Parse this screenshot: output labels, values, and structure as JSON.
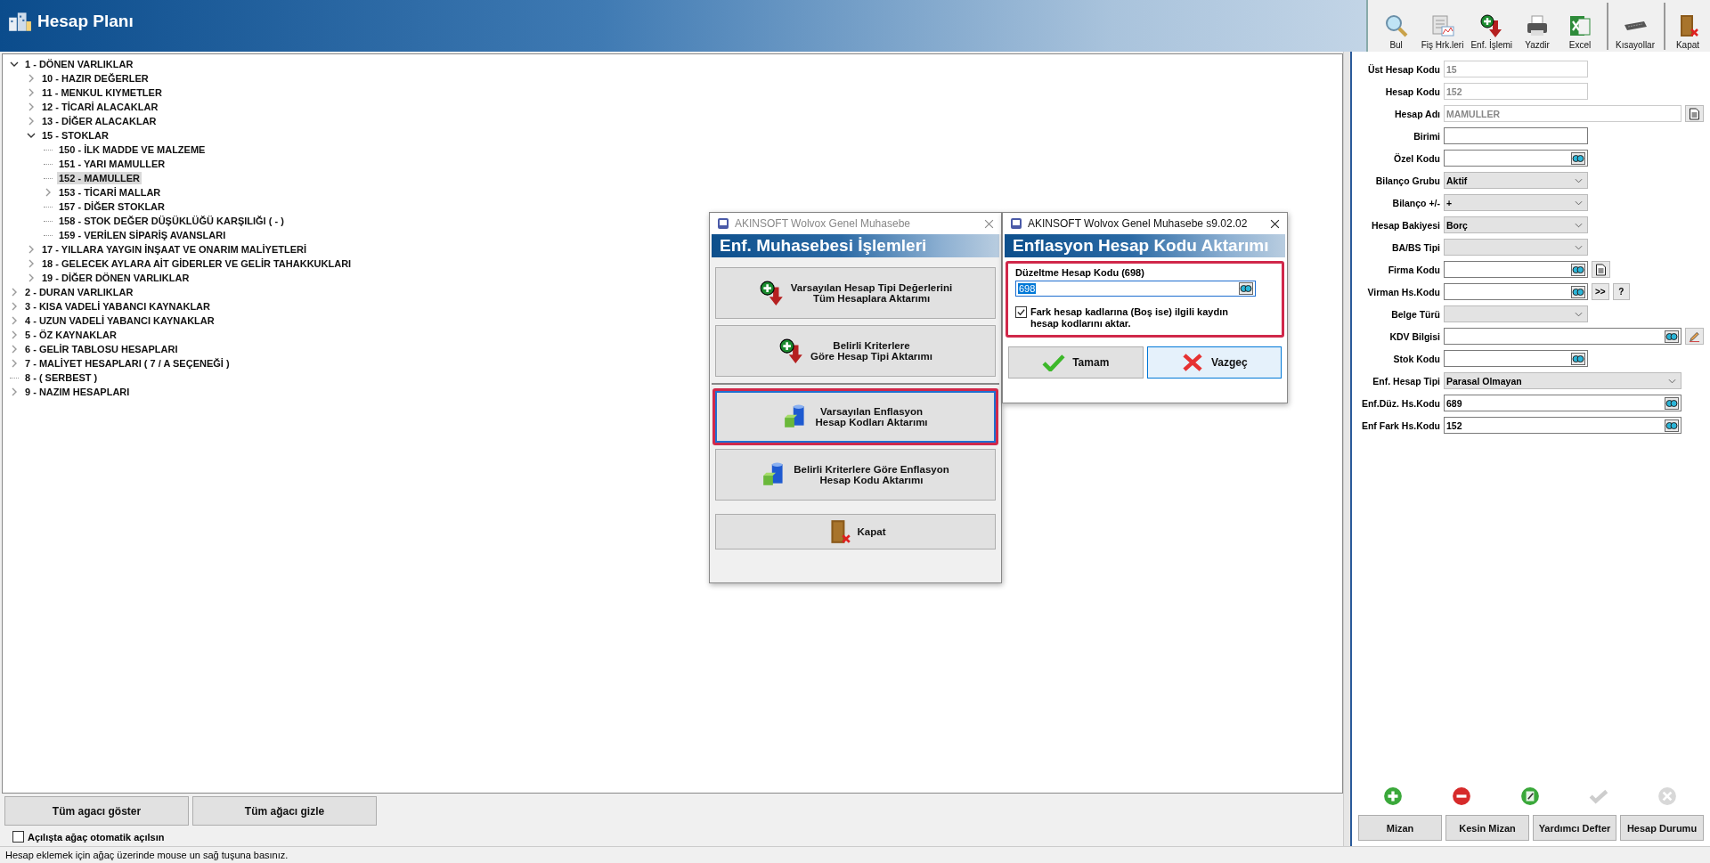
{
  "window": {
    "title": "Hesap Planı"
  },
  "toolbar": [
    {
      "label": "Bul",
      "kind": "search",
      "separated": false
    },
    {
      "label": "Fiş Hrk.leri",
      "kind": "report",
      "separated": false
    },
    {
      "label": "Enf. İşlemi",
      "kind": "add-down",
      "separated": false
    },
    {
      "label": "Yazdir",
      "kind": "printer",
      "separated": false
    },
    {
      "label": "Excel",
      "kind": "excel",
      "separated": false
    },
    {
      "label": "Kısayollar",
      "kind": "keyboard",
      "separated": true
    },
    {
      "label": "Kapat",
      "kind": "door",
      "separated": true
    }
  ],
  "tree": [
    {
      "label": "1 - DÖNEN VARLIKLAR",
      "expanded": true,
      "selected": false,
      "children": [
        {
          "label": "10 - HAZIR DEĞERLER",
          "expanded": false,
          "selected": false
        },
        {
          "label": "11 - MENKUL KIYMETLER",
          "expanded": false,
          "selected": false
        },
        {
          "label": "12 - TİCARİ ALACAKLAR",
          "expanded": false,
          "selected": false
        },
        {
          "label": "13 - DİĞER ALACAKLAR",
          "expanded": false,
          "selected": false
        },
        {
          "label": "15 - STOKLAR",
          "expanded": true,
          "selected": false,
          "children": [
            {
              "label": "150 - İLK MADDE VE MALZEME",
              "selected": false
            },
            {
              "label": "151 - YARI MAMULLER",
              "selected": false
            },
            {
              "label": "152 - MAMULLER",
              "selected": true
            },
            {
              "label": "153 - TİCARİ MALLAR",
              "expanded": false,
              "selected": false
            },
            {
              "label": "157 - DİĞER STOKLAR",
              "selected": false
            },
            {
              "label": "158 - STOK DEĞER DÜŞÜKLÜĞÜ KARŞILIĞI ( - )",
              "selected": false
            },
            {
              "label": "159 - VERİLEN SİPARİŞ AVANSLARI",
              "selected": false
            }
          ]
        },
        {
          "label": "17 - YILLARA YAYGIN İNŞAAT VE ONARIM MALİYETLERİ",
          "expanded": false,
          "selected": false
        },
        {
          "label": "18 - GELECEK AYLARA AİT GİDERLER VE GELİR TAHAKKUKLARI",
          "expanded": false,
          "selected": false
        },
        {
          "label": "19 - DİĞER DÖNEN VARLIKLAR",
          "expanded": false,
          "selected": false
        }
      ]
    },
    {
      "label": "2 - DURAN VARLIKLAR",
      "expanded": false,
      "selected": false
    },
    {
      "label": "3 - KISA VADELİ YABANCI KAYNAKLAR",
      "expanded": false,
      "selected": false
    },
    {
      "label": "4 - UZUN VADELİ YABANCI KAYNAKLAR",
      "expanded": false,
      "selected": false
    },
    {
      "label": "5 - ÖZ KAYNAKLAR",
      "expanded": false,
      "selected": false
    },
    {
      "label": "6 - GELİR TABLOSU HESAPLARI",
      "expanded": false,
      "selected": false
    },
    {
      "label": "7 - MALİYET HESAPLARI ( 7 / A  SEÇENEĞİ )",
      "expanded": false,
      "selected": false
    },
    {
      "label": "8 - ( SERBEST )",
      "selected": false
    },
    {
      "label": "9 - NAZIM HESAPLARI",
      "expanded": false,
      "selected": false
    }
  ],
  "tree_buttons": [
    "Tüm agacı göster",
    "Tüm ağacı gizle"
  ],
  "auto_expand": {
    "label": "Açılışta ağaç otomatik açılsın",
    "checked": false
  },
  "form": [
    {
      "label": "Üst Hesap Kodu",
      "kind": "text",
      "value": "15",
      "disabled": true,
      "wide": false
    },
    {
      "label": "Hesap Kodu",
      "kind": "text",
      "value": "152",
      "disabled": true,
      "wide": false
    },
    {
      "label": "Hesap Adı",
      "kind": "text",
      "value": "MAMULLER",
      "disabled": true,
      "wide": true,
      "extras": [
        {
          "kind": "note"
        }
      ]
    },
    {
      "label": "Birimi",
      "kind": "text",
      "disabled": false,
      "wide": false
    },
    {
      "label": "Özel Kodu",
      "kind": "lookup",
      "disabled": false,
      "wide": false
    },
    {
      "label": "Bilanço Grubu",
      "kind": "select",
      "value": "Aktif",
      "disabled": false,
      "wide": false
    },
    {
      "label": "Bilanço +/-",
      "kind": "select",
      "value": "+",
      "disabled": false,
      "wide": false
    },
    {
      "label": "Hesap Bakiyesi",
      "kind": "select",
      "value": "Borç",
      "disabled": false,
      "wide": false
    },
    {
      "label": "BA/BS Tipi",
      "kind": "select",
      "disabled": false,
      "wide": false
    },
    {
      "label": "Firma Kodu",
      "kind": "lookup",
      "disabled": false,
      "wide": false,
      "extras": [
        {
          "kind": "note"
        }
      ]
    },
    {
      "label": "Virman Hs.Kodu",
      "kind": "lookup",
      "disabled": false,
      "wide": false,
      "extras": [
        {
          "kind": "text",
          "label": ">>"
        },
        {
          "kind": "text",
          "label": "?"
        }
      ]
    },
    {
      "label": "Belge Türü",
      "kind": "select",
      "disabled": false,
      "wide": false
    },
    {
      "label": "KDV Bilgisi",
      "kind": "lookup",
      "disabled": false,
      "wide": true,
      "extras": [
        {
          "kind": "pencil"
        }
      ]
    },
    {
      "label": "Stok Kodu",
      "kind": "lookup",
      "disabled": false,
      "wide": false
    },
    {
      "label": "Enf. Hesap Tipi",
      "kind": "select",
      "value": "Parasal Olmayan",
      "disabled": false,
      "wide": true
    },
    {
      "label": "Enf.Düz. Hs.Kodu",
      "kind": "lookup",
      "value": "689",
      "disabled": false,
      "wide": true
    },
    {
      "label": "Enf Fark Hs.Kodu",
      "kind": "lookup",
      "value": "152",
      "disabled": false,
      "wide": true
    }
  ],
  "record_icons": [
    {
      "kind": "add",
      "disabled": false
    },
    {
      "kind": "delete",
      "disabled": false
    },
    {
      "kind": "edit",
      "disabled": false
    },
    {
      "kind": "confirm",
      "disabled": true
    },
    {
      "kind": "cancel",
      "disabled": true
    }
  ],
  "report_buttons": [
    "Mizan",
    "Kesin Mizan",
    "Yardımcı Defter",
    "Hesap Durumu"
  ],
  "status_bar": "Hesap eklemek için ağaç üzerinde mouse un sağ tuşuna basınız.",
  "operations_dialog": {
    "title": "AKINSOFT Wolvox Genel Muhasebe",
    "active": false,
    "heading": "Enf. Muhasebesi İşlemleri",
    "buttons": [
      {
        "label": "Varsayılan Hesap Tipi Değerlerini\nTüm Hesaplara Aktarımı",
        "kind": "add-down",
        "highlighted": false
      },
      {
        "label": "Belirli Kriterlere\nGöre Hesap Tipi Aktarımı",
        "kind": "add-down",
        "highlighted": false
      },
      {
        "label": "Varsayılan Enflasyon\nHesap Kodları Aktarımı",
        "kind": "cylinder",
        "highlighted": true
      },
      {
        "label": "Belirli Kriterlere Göre Enflasyon\nHesap Kodu Aktarımı",
        "kind": "cylinder",
        "highlighted": false
      }
    ],
    "close_button": "Kapat"
  },
  "transfer_dialog": {
    "title": "AKINSOFT Wolvox Genel Muhasebe s9.02.02",
    "active": true,
    "heading": "Enflasyon Hesap Kodu Aktarımı",
    "highlighted": true,
    "field": {
      "label": "Düzeltme Hesap Kodu (698)",
      "value": "698"
    },
    "option": {
      "label": "Fark hesap kadlarına (Boş ise) ilgili kaydın hesap kodlarını aktar.",
      "checked": true
    },
    "buttons": [
      {
        "label": "Tamam",
        "kind": "ok",
        "selected": false
      },
      {
        "label": "Vazgeç",
        "kind": "cancel",
        "selected": true
      }
    ]
  }
}
